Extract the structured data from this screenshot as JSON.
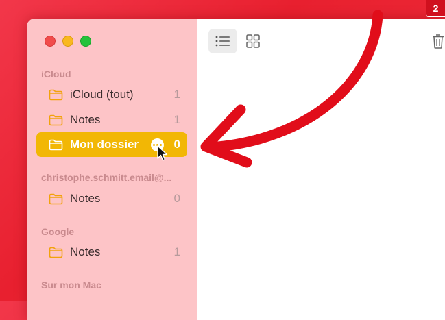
{
  "sidebar": {
    "sections": [
      {
        "title": "iCloud",
        "items": [
          {
            "label": "iCloud (tout)",
            "count": "1"
          },
          {
            "label": "Notes",
            "count": "1"
          },
          {
            "label": "Mon dossier",
            "count": "0",
            "selected": true
          }
        ]
      },
      {
        "title": "christophe.schmitt.email@...",
        "items": [
          {
            "label": "Notes",
            "count": "0"
          }
        ]
      },
      {
        "title": "Google",
        "items": [
          {
            "label": "Notes",
            "count": "1"
          }
        ]
      },
      {
        "title": "Sur mon Mac",
        "items": []
      }
    ]
  },
  "toolbar": {
    "list_view_icon": "list-view-icon",
    "gallery_view_icon": "gallery-view-icon",
    "trash_icon": "trash-icon"
  },
  "badge": {
    "text": "2"
  },
  "colors": {
    "background": "#e8202f",
    "sidebar": "#fdc4c7",
    "selection": "#f2b705",
    "folder_icon": "#f2a20c",
    "arrow": "#e10d1a"
  }
}
